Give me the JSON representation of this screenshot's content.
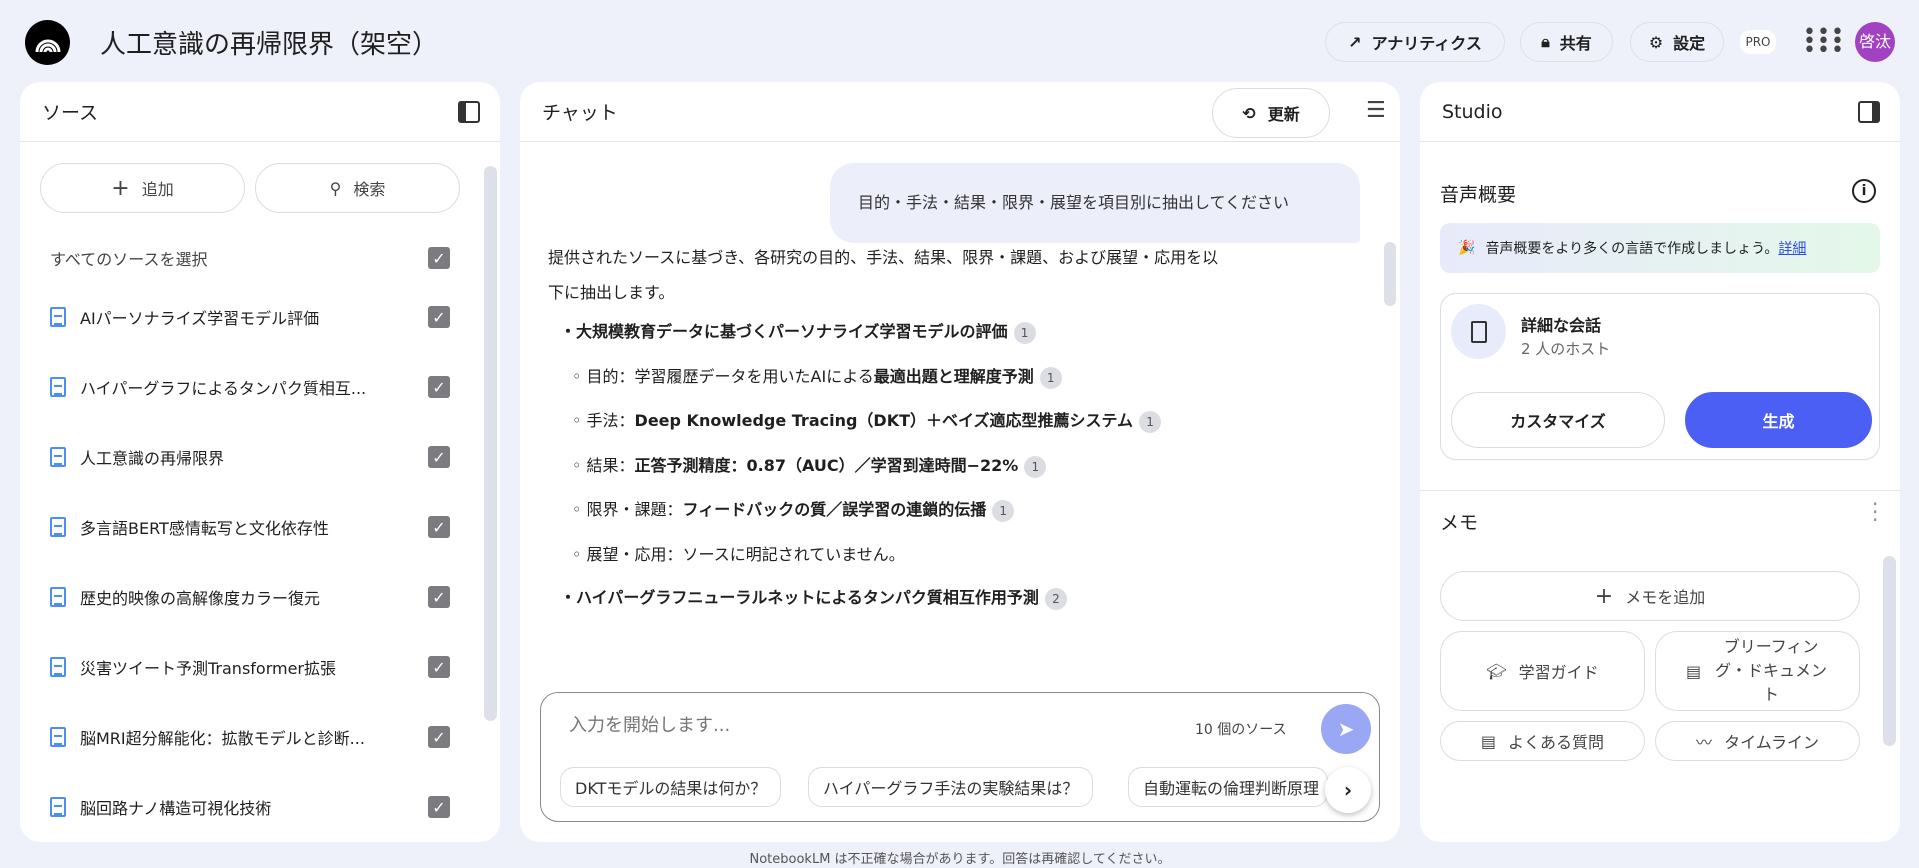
{
  "header": {
    "title": "人工意識の再帰限界（架空）",
    "analytics": "アナリティクス",
    "share": "共有",
    "settings": "設定",
    "pro": "PRO",
    "avatar": "啓汰",
    "avatar_color": "#a142c2"
  },
  "sources": {
    "title": "ソース",
    "add": "追加",
    "search": "検索",
    "select_all": "すべてのソースを選択",
    "items": [
      {
        "label": "AIパーソナライズ学習モデル評価"
      },
      {
        "label": "ハイパーグラフによるタンパク質相互..."
      },
      {
        "label": "人工意識の再帰限界"
      },
      {
        "label": "多言語BERT感情転写と文化依存性"
      },
      {
        "label": "歴史的映像の高解像度カラー復元"
      },
      {
        "label": "災害ツイート予測Transformer拡張"
      },
      {
        "label": "脳MRI超分解能化：拡散モデルと診断..."
      },
      {
        "label": "脳回路ナノ構造可視化技術"
      }
    ]
  },
  "chat": {
    "title": "チャット",
    "refresh": "更新",
    "user_message": "目的・手法・結果・限界・展望を項目別に抽出してください",
    "intro1": "提供されたソースに基づき、各研究の目的、手法、結果、限界・課題、および展望・応用を以",
    "intro2": "下に抽出します。",
    "s1": {
      "title": "・大規模教育データに基づくパーソナライズ学習モデルの評価",
      "cite": "1",
      "purpose_label": "◦ 目的：学習履歴データを用いたAIによる",
      "purpose_bold": "最適出題と理解度予測",
      "method_label": "◦ 手法：",
      "method_bold": "Deep Knowledge Tracing（DKT）＋ベイズ適応型推薦システム",
      "result_label": "◦ 結果：",
      "result_bold": "正答予測精度：0.87（AUC）／学習到達時間−22%",
      "limit_label": "◦ 限界・課題：",
      "limit_bold": "フィードバックの質／誤学習の連鎖的伝播",
      "outlook": "◦ 展望・応用：ソースに明記されていません。",
      "cite_n": "1"
    },
    "s2": {
      "title": "・ハイパーグラフニューラルネットによるタンパク質相互作用予測",
      "cite": "2"
    },
    "input_placeholder": "入力を開始します...",
    "source_count": "10 個のソース",
    "suggestions": [
      "DKTモデルの結果は何か？",
      "ハイパーグラフ手法の実験結果は？",
      "自動運転の倫理判断原理"
    ],
    "disclaimer": "NotebookLM は不正確な場合があります。回答は再確認してください。"
  },
  "studio": {
    "title": "Studio",
    "audio_title": "音声概要",
    "banner": "音声概要をより多くの言語で作成しましょう。",
    "banner_link": "詳細",
    "card_title": "詳細な会話",
    "card_sub": "2 人のホスト",
    "customize": "カスタマイズ",
    "generate": "生成",
    "accent": "#4c5ff5",
    "memo_title": "メモ",
    "add_memo": "メモを追加",
    "study_guide": "学習ガイド",
    "briefing": "ブリーフィング・ドキュメント",
    "faq": "よくある質問",
    "timeline": "タイムライン"
  }
}
